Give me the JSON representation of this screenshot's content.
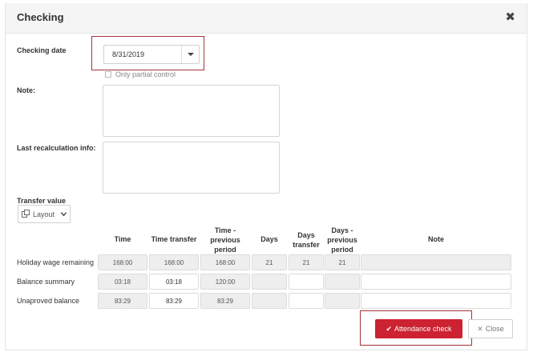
{
  "dialog": {
    "title": "Checking",
    "close_glyph": "✖"
  },
  "form": {
    "checking_date_label": "Checking date",
    "checking_date_value": "8/31/2019",
    "partial_control_label": "Only partial control",
    "partial_control_checked": false,
    "note_label": "Note:",
    "last_recalc_label": "Last recalculation info:",
    "transfer_value_label": "Transfer value",
    "layout_button_label": "Layout"
  },
  "table": {
    "columns": [
      "Time",
      "Time transfer",
      "Time - previous period",
      "Days",
      "Days transfer",
      "Days - previous period",
      "Note"
    ],
    "rows": [
      {
        "label": "Holiday wage remaining",
        "cells": [
          "168:00",
          "168:00",
          "168:00",
          "21",
          "21",
          "21",
          ""
        ]
      },
      {
        "label": "Balance summary",
        "cells": [
          "03:18",
          "03:18",
          "120:00",
          "",
          "",
          "",
          ""
        ]
      },
      {
        "label": "Unaproved balance",
        "cells": [
          "83:29",
          "83:29",
          "83:29",
          "",
          "",
          "",
          ""
        ]
      }
    ]
  },
  "footer": {
    "attendance_check_label": "Attendance check",
    "close_label": "Close"
  },
  "colors": {
    "primary_red": "#cc2231",
    "highlight_frame": "#a8323c"
  },
  "icons": [
    "close-icon",
    "chevron-down-icon",
    "layout-icon",
    "checkmark-icon",
    "close-x-icon"
  ]
}
